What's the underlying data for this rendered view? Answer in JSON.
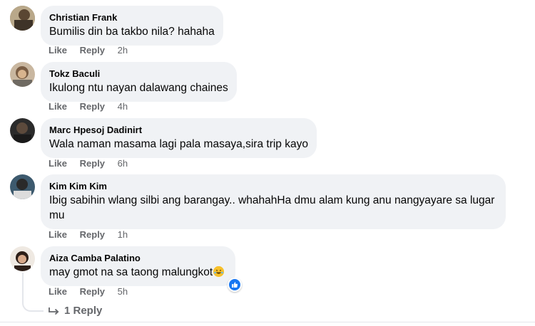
{
  "comments": [
    {
      "author": "Christian Frank",
      "text": "Bumilis din ba takbo nila? hahaha",
      "like": "Like",
      "reply": "Reply",
      "time": "2h"
    },
    {
      "author": "Tokz Baculi",
      "text": "Ikulong ntu nayan dalawang chaines",
      "like": "Like",
      "reply": "Reply",
      "time": "4h"
    },
    {
      "author": "Marc Hpesoj Dadinirt",
      "text": "Wala naman masama lagi pala masaya,sira trip kayo",
      "like": "Like",
      "reply": "Reply",
      "time": "6h"
    },
    {
      "author": "Kim Kim Kim",
      "text": "Ibig sabihin wlang silbi ang barangay.. whahahHa dmu alam kung anu nangyayare sa lugar mu",
      "like": "Like",
      "reply": "Reply",
      "time": "1h"
    },
    {
      "author": "Aiza Camba Palatino",
      "text": "may gmot na sa taong malungkot",
      "like": "Like",
      "reply": "Reply",
      "time": "5h"
    }
  ],
  "replies_link": "1 Reply",
  "colors": {
    "bubble": "#f0f2f5",
    "meta": "#65676b",
    "like_blue": "#1877f2"
  },
  "icons": {
    "reaction": "like-reaction-icon",
    "emoji": "laughing-emoji-icon",
    "reply": "reply-arrow-icon"
  }
}
